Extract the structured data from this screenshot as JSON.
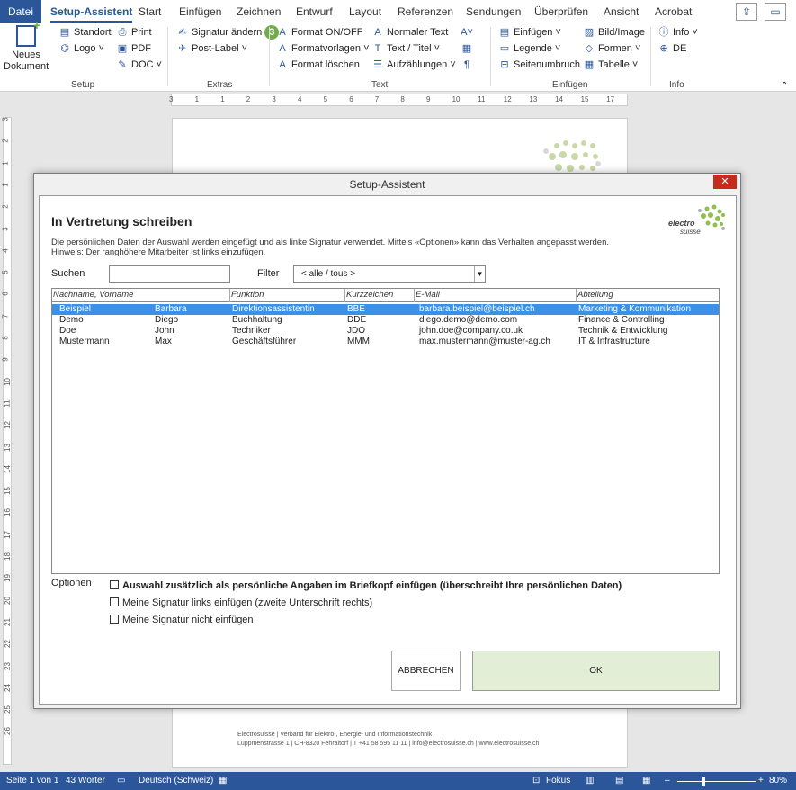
{
  "tabs": [
    {
      "label": "Datei"
    },
    {
      "label": "Setup-Assistent"
    },
    {
      "label": "Start"
    },
    {
      "label": "Einfügen"
    },
    {
      "label": "Zeichnen"
    },
    {
      "label": "Entwurf"
    },
    {
      "label": "Layout"
    },
    {
      "label": "Referenzen"
    },
    {
      "label": "Sendungen"
    },
    {
      "label": "Überprüfen"
    },
    {
      "label": "Ansicht"
    },
    {
      "label": "Acrobat"
    }
  ],
  "ribbon": {
    "setup": {
      "label": "Setup",
      "new_doc": "Neues Dokument",
      "standort": "Standort",
      "logo": "Logo ˅",
      "print": "Print",
      "pdf": "PDF",
      "doc": "DOC ˅"
    },
    "extras": {
      "label": "Extras",
      "signatur": "Signatur ändern",
      "signatur_badge": "3",
      "post_label": "Post-Label ˅"
    },
    "text": {
      "label": "Text",
      "format_onoff": "Format ON/OFF",
      "formatvorlagen": "Formatvorlagen ˅",
      "format_loeschen": "Format löschen",
      "normaler_text": "Normaler Text",
      "text_titel": "Text / Titel ˅",
      "aufzaehlungen": "Aufzählungen ˅"
    },
    "einfuegen": {
      "label": "Einfügen",
      "einfuegen": "Einfügen ˅",
      "legende": "Legende ˅",
      "seitenumbruch": "Seitenumbruch",
      "bild": "Bild/Image",
      "formen": "Formen ˅",
      "tabelle": "Tabelle ˅"
    },
    "info": {
      "label": "Info",
      "info": "Info ˅",
      "de": "DE"
    }
  },
  "ruler_numbers_h": [
    "3",
    "1",
    "1",
    "2",
    "3",
    "4",
    "5",
    "6",
    "7",
    "8",
    "9",
    "10",
    "11",
    "12",
    "13",
    "14",
    "15",
    "17"
  ],
  "ruler_numbers_v": [
    "3",
    "2",
    "1",
    "1",
    "2",
    "3",
    "4",
    "5",
    "6",
    "7",
    "8",
    "9",
    "10",
    "11",
    "12",
    "13",
    "14",
    "15",
    "16",
    "17",
    "18",
    "19",
    "20",
    "21",
    "22",
    "23",
    "24",
    "25",
    "26"
  ],
  "page": {
    "footer_line1": "Electrosuisse | Verband für Elektro-, Energie- und Informationstechnik",
    "footer_line2": "Luppmenstrasse 1 | CH-8320 Fehraltorf | T +41 58 595 11 11 | info@electrosuisse.ch | www.electrosuisse.ch"
  },
  "dialog": {
    "title": "Setup-Assistent",
    "close": "✕",
    "heading": "In Vertretung schreiben",
    "desc1": "Die persönlichen Daten der Auswahl werden eingefügt und als linke Signatur verwendet. Mittels «Optionen» kann das Verhalten angepasst werden.",
    "desc2": "Hinweis: Der ranghöhere Mitarbeiter ist links einzufügen.",
    "logo_line1": "electro",
    "logo_line2": "suisse",
    "search_label": "Suchen",
    "search_value": "",
    "filter_label": "Filter",
    "filter_value": "< alle / tous >",
    "columns": [
      "Nachname, Vorname",
      "Funktion",
      "Kurzzeichen",
      "E-Mail",
      "Abteilung"
    ],
    "rows": [
      {
        "nachname": "Beispiel",
        "vorname": "Barbara",
        "funktion": "Direktionsassistentin",
        "kurz": "BBE",
        "email": "barbara.beispiel@beispiel.ch",
        "abteilung": "Marketing & Kommunikation"
      },
      {
        "nachname": "Demo",
        "vorname": "Diego",
        "funktion": "Buchhaltung",
        "kurz": "DDE",
        "email": "diego.demo@demo.com",
        "abteilung": "Finance & Controlling"
      },
      {
        "nachname": "Doe",
        "vorname": "John",
        "funktion": "Techniker",
        "kurz": "JDO",
        "email": "john.doe@company.co.uk",
        "abteilung": "Technik & Entwicklung"
      },
      {
        "nachname": "Mustermann",
        "vorname": "Max",
        "funktion": "Geschäftsführer",
        "kurz": "MMM",
        "email": "max.mustermann@muster-ag.ch",
        "abteilung": "IT & Infrastructure"
      }
    ],
    "options_label": "Optionen",
    "option1": "Auswahl zusätzlich als persönliche Angaben im Briefkopf einfügen (überschreibt Ihre persönlichen Daten)",
    "option2": "Meine Signatur links einfügen (zweite Unterschrift rechts)",
    "option3": "Meine Signatur nicht einfügen",
    "cancel": "ABBRECHEN",
    "ok": "OK"
  },
  "status": {
    "page": "Seite 1 von 1",
    "words": "43 Wörter",
    "language": "Deutsch (Schweiz)",
    "focus": "Fokus",
    "zoom": "80%"
  },
  "colors": {
    "brand": "#2b579a",
    "selection": "#3c91e6",
    "ok_button": "#e2efd6",
    "badge": "#70ad47",
    "close": "#c42b1c"
  }
}
